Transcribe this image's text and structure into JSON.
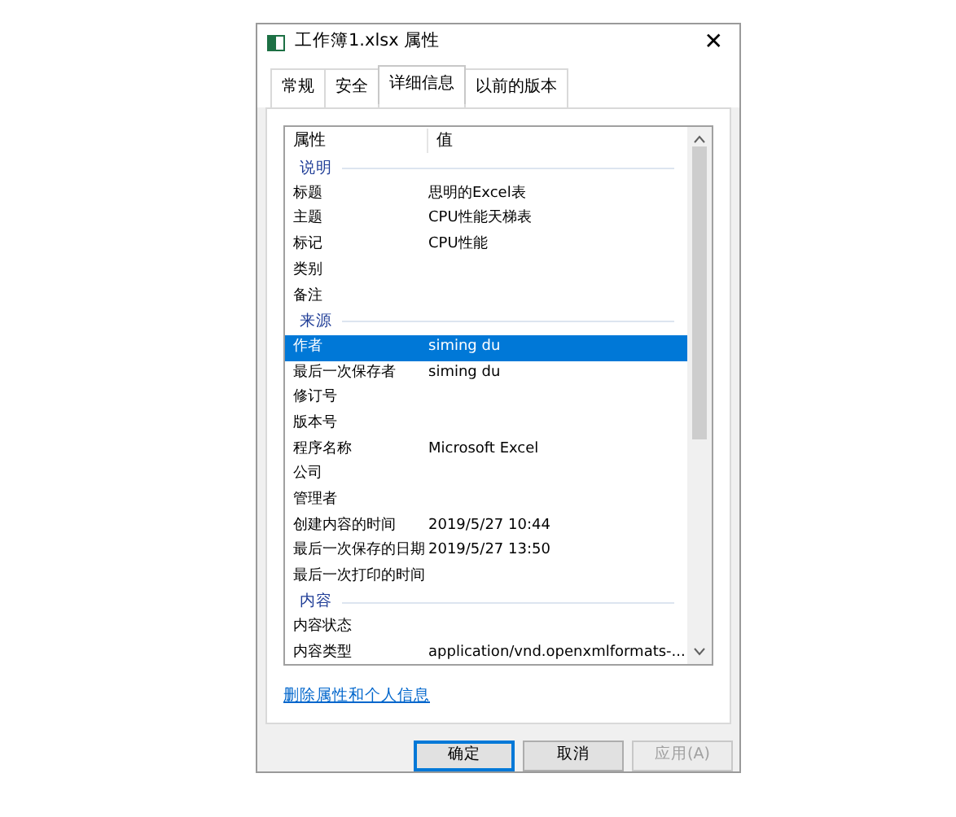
{
  "window": {
    "title": "工作簿1.xlsx 属性",
    "close": "✕"
  },
  "tabs": [
    {
      "label": "常规",
      "selected": false
    },
    {
      "label": "安全",
      "selected": false
    },
    {
      "label": "详细信息",
      "selected": true
    },
    {
      "label": "以前的版本",
      "selected": false
    }
  ],
  "details": {
    "columns": [
      "属性",
      "值"
    ],
    "rows": [
      {
        "kind": "group",
        "name": "说明"
      },
      {
        "kind": "property",
        "name": "标题",
        "value": "思明的Excel表",
        "selected": false
      },
      {
        "kind": "property",
        "name": "主题",
        "value": "CPU性能天梯表",
        "selected": false
      },
      {
        "kind": "property",
        "name": "标记",
        "value": "CPU性能",
        "selected": false
      },
      {
        "kind": "property",
        "name": "类别",
        "selected": false
      },
      {
        "kind": "property",
        "name": "备注",
        "selected": false
      },
      {
        "kind": "group",
        "name": "来源"
      },
      {
        "kind": "property",
        "name": "作者",
        "value": "siming du",
        "selected": true
      },
      {
        "kind": "property",
        "name": "最后一次保存者",
        "value": "siming du",
        "selected": false
      },
      {
        "kind": "property",
        "name": "修订号",
        "selected": false
      },
      {
        "kind": "property",
        "name": "版本号",
        "selected": false
      },
      {
        "kind": "property",
        "name": "程序名称",
        "value": "Microsoft Excel",
        "selected": false
      },
      {
        "kind": "property",
        "name": "公司",
        "selected": false
      },
      {
        "kind": "property",
        "name": "管理者",
        "selected": false
      },
      {
        "kind": "property",
        "name": "创建内容的时间",
        "value": "2019/5/27 10:44",
        "selected": false
      },
      {
        "kind": "property",
        "name": "最后一次保存的日期",
        "value": "2019/5/27 13:50",
        "selected": false
      },
      {
        "kind": "property",
        "name": "最后一次打印的时间",
        "selected": false
      },
      {
        "kind": "group",
        "name": "内容"
      },
      {
        "kind": "property",
        "name": "内容状态",
        "selected": false
      },
      {
        "kind": "property",
        "name": "内容类型",
        "value": "application/vnd.openxmlformats-...",
        "selected": false
      }
    ]
  },
  "link": "删除属性和个人信息",
  "buttons": [
    {
      "label": "确定",
      "disabled": false,
      "default": true
    },
    {
      "label": "取消",
      "disabled": false,
      "default": false
    },
    {
      "label": "应用(A)",
      "disabled": true,
      "default": false
    }
  ]
}
